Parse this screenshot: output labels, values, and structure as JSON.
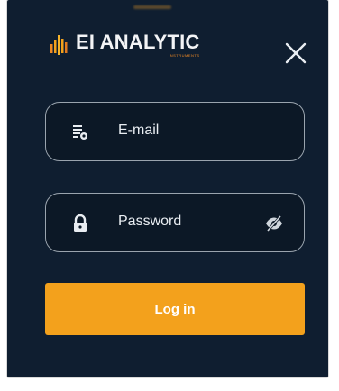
{
  "brand": {
    "name": "EI ANALYTIC",
    "tagline": "INSTRUMENTS",
    "accent_color": "#f08a24",
    "logo_icon": "bar-chart-flame-logo"
  },
  "header": {
    "close_icon": "close-icon"
  },
  "form": {
    "email": {
      "label": "E-mail",
      "icon": "email-field-icon"
    },
    "password": {
      "label": "Password",
      "icon": "lock-icon",
      "toggle_icon": "eye-slash-icon"
    },
    "login_label": "Log in",
    "login_color": "#f3a11c"
  },
  "theme": {
    "panel_background": "#0f1e30",
    "field_border": "#9aa4ae"
  }
}
